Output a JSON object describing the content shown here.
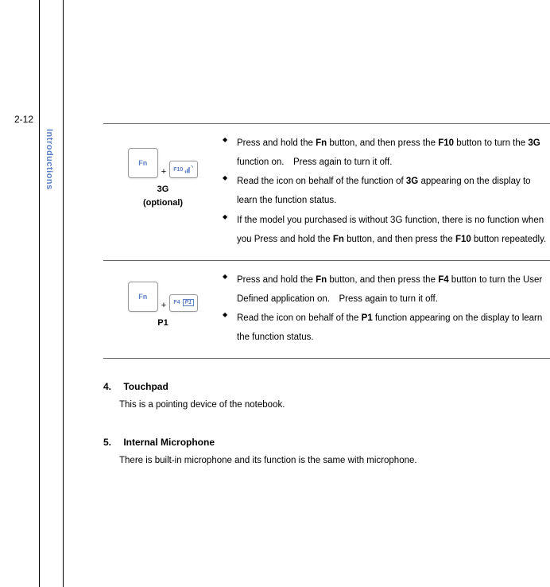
{
  "page_number": "2-12",
  "side_label": "Introductions",
  "rows": [
    {
      "key_big": "Fn",
      "key_small_label": "F10",
      "caption_line1": "3G",
      "caption_line2": "(optional)",
      "bullets": [
        "Press and hold the <b>Fn</b> button, and then press the <b>F10</b> button to turn the <b>3G</b> function on. Press again to turn it off.",
        "Read the icon on behalf of the function of <b>3G</b> appearing on the display to learn the function status.",
        "If the model you purchased is without 3G function, there is no function when you Press and hold the <b>Fn</b> button, and then press the <b>F10</b> button repeatedly."
      ]
    },
    {
      "key_big": "Fn",
      "key_small_label": "F4",
      "key_small_label2": "P1",
      "caption_line1": "P1",
      "bullets": [
        "Press and hold the <b>Fn</b> button, and then press the <b>F4</b> button to turn the User Defined application on. Press again to turn it off.",
        "Read the icon on behalf of the <b>P1</b> function appearing on the display to learn the function status."
      ]
    }
  ],
  "sections": [
    {
      "num": "4.",
      "title": "Touchpad",
      "body": "This is a pointing device of the notebook."
    },
    {
      "num": "5.",
      "title": "Internal Microphone",
      "body": "There is built-in microphone and its function is the same with microphone."
    }
  ]
}
